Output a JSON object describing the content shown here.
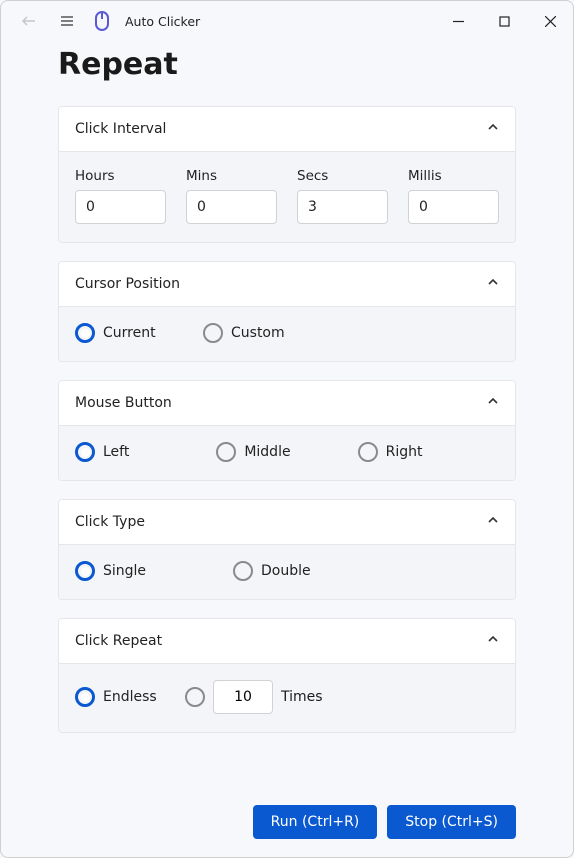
{
  "header": {
    "app_name": "Auto Clicker",
    "page_title": "Repeat"
  },
  "interval": {
    "title": "Click Interval",
    "hours_label": "Hours",
    "mins_label": "Mins",
    "secs_label": "Secs",
    "millis_label": "Millis",
    "hours": "0",
    "mins": "0",
    "secs": "3",
    "millis": "0"
  },
  "cursor": {
    "title": "Cursor Position",
    "current": "Current",
    "custom": "Custom",
    "selected": "current"
  },
  "mouse": {
    "title": "Mouse Button",
    "left": "Left",
    "middle": "Middle",
    "right": "Right",
    "selected": "left"
  },
  "clicktype": {
    "title": "Click Type",
    "single": "Single",
    "double": "Double",
    "selected": "single"
  },
  "repeat": {
    "title": "Click Repeat",
    "endless": "Endless",
    "count": "10",
    "times": "Times",
    "selected": "endless"
  },
  "actions": {
    "run": "Run (Ctrl+R)",
    "stop": "Stop (Ctrl+S)"
  }
}
